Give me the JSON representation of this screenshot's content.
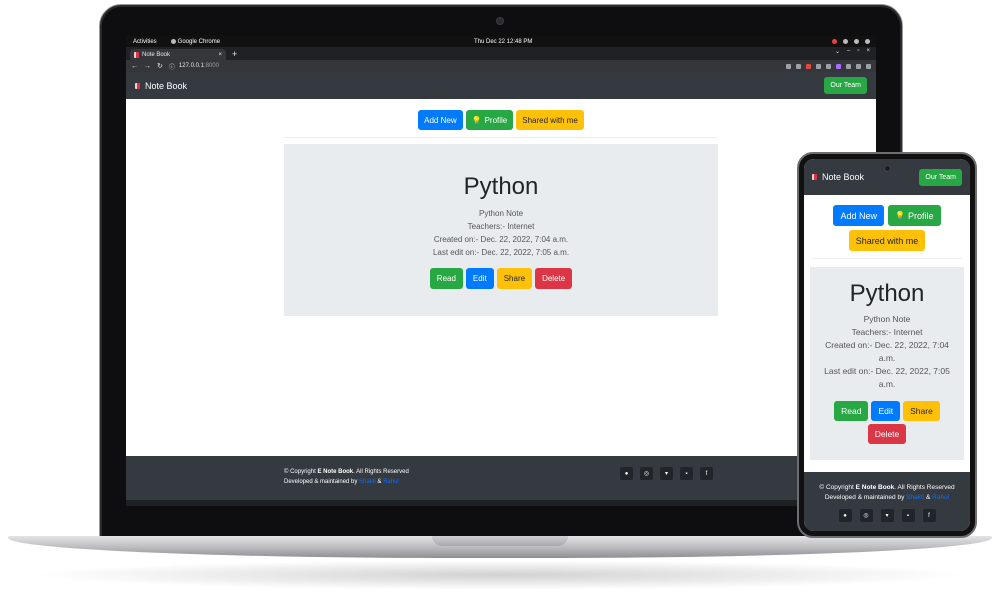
{
  "os_bar": {
    "activities": "Activities",
    "app_name": "Google Chrome",
    "clock": "Thu Dec 22  12:48 PM"
  },
  "browser": {
    "tab_title": "Note Book",
    "tab_close": "×",
    "new_tab": "+",
    "url_host": "127.0.0.1",
    "url_port": ":8000",
    "win_controls": [
      "⌄",
      "–",
      "▫",
      "×"
    ]
  },
  "app": {
    "brand": "Note Book",
    "team_button": "Our Team",
    "actions": {
      "add_new": "Add New",
      "profile": "Profile",
      "shared": "Shared with me"
    },
    "note": {
      "title": "Python",
      "subtitle": "Python Note",
      "teachers": "Teachers:- Internet",
      "created": "Created on:- Dec. 22, 2022, 7:04 a.m.",
      "last_edit": "Last edit on:- Dec. 22, 2022, 7:05 a.m."
    },
    "note_actions": {
      "read": "Read",
      "edit": "Edit",
      "share": "Share",
      "delete": "Delete"
    },
    "footer": {
      "copyright_prefix": "© Copyright ",
      "brand": "E Note Book",
      "copyright_suffix": ". All Rights Reserved",
      "developed": "Developed & maintained by ",
      "author1": "Shakti",
      "amp": " & ",
      "author2": "Rahul"
    },
    "socials": [
      "github-icon",
      "instagram-icon",
      "twitter-icon",
      "linkedin-icon",
      "facebook-icon"
    ]
  },
  "phone": {
    "note_created_a": "Created on:- Dec. 22, 2022, 7:04",
    "note_created_b": "a.m.",
    "note_edit_a": "Last edit on:- Dec. 22, 2022, 7:05",
    "note_edit_b": "a.m."
  },
  "colors": {
    "navbar": "#343a40",
    "primary": "#007bff",
    "success": "#28a745",
    "warning": "#ffc107",
    "danger": "#dc3545",
    "card": "#e9ecef"
  }
}
